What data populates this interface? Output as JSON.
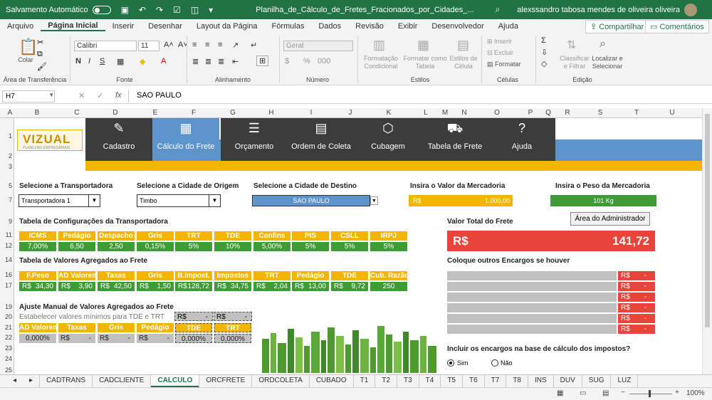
{
  "titlebar": {
    "autosave": "Salvamento Automático",
    "filename": "Planilha_de_Cálculo_de_Fretes_Fracionados_por_Cidades_...",
    "user": "alexssandro tabosa mendes de oliveira oliveira"
  },
  "tabs": [
    "Arquivo",
    "Página Inicial",
    "Inserir",
    "Desenhar",
    "Layout da Página",
    "Fórmulas",
    "Dados",
    "Revisão",
    "Exibir",
    "Desenvolvedor",
    "Ajuda"
  ],
  "share": {
    "compartilhar": "Compartilhar",
    "comentarios": "Comentários"
  },
  "ribbon": {
    "colar": "Colar",
    "area_transferencia": "Área de Transferência",
    "font_name": "Calibri",
    "font_size": "11",
    "fonte": "Fonte",
    "alinhamento": "Alinhamento",
    "num_format": "Geral",
    "numero": "Número",
    "cond_format": "Formatação Condicional",
    "fmt_tabela": "Formatar como Tabela",
    "estilos_cel": "Estilos de Célula",
    "estilos": "Estilos",
    "inserir": "Inserir",
    "excluir": "Excluir",
    "formatar": "Formatar",
    "celulas": "Células",
    "classificar": "Classificar e Filtrar",
    "localizar": "Localizar e Selecionar",
    "edicao": "Edição",
    "sum": "Σ"
  },
  "formula": {
    "namebox": "H7",
    "fx": "fx",
    "value": "SAO PAULO"
  },
  "columns": [
    "A",
    "B",
    "C",
    "D",
    "E",
    "F",
    "G",
    "H",
    "I",
    "J",
    "K",
    "L",
    "M",
    "N",
    "O",
    "P",
    "Q",
    "R",
    "S",
    "T",
    "U"
  ],
  "rows": [
    "1",
    "2",
    "3",
    "5",
    "7",
    "9",
    "11",
    "12",
    "14",
    "16",
    "17",
    "19",
    "20",
    "21",
    "22",
    "23",
    "24",
    "25"
  ],
  "banner": {
    "logo": "VIZUAL",
    "logo_sub": "PLANILHAS EMPRESARIAIS",
    "nav": [
      {
        "label": "Cadastro",
        "icon": "✎"
      },
      {
        "label": "Cálculo do Frete",
        "icon": "▦"
      },
      {
        "label": "Orçamento",
        "icon": "☰"
      },
      {
        "label": "Ordem de Coleta",
        "icon": "▤"
      },
      {
        "label": "Cubagem",
        "icon": "⬡"
      },
      {
        "label": "Tabela de Frete",
        "icon": "⛟"
      },
      {
        "label": "Ajuda",
        "icon": "?"
      }
    ]
  },
  "selectors": {
    "transportadora_label": "Selecione a Transportadora",
    "transportadora_value": "Transportadora 1",
    "origem_label": "Selecione a Cidade de Origem",
    "origem_value": "Timbo",
    "destino_label": "Selecione a Cidade de Destino",
    "destino_value": "SAO PAULO",
    "valor_label": "Insira o Valor da Mercadoria",
    "valor_currency": "R$",
    "valor_value": "1.000,00",
    "peso_label": "Insira o Peso da Mercadoria",
    "peso_value": "101 Kg"
  },
  "config": {
    "title": "Tabela de Configurações da Transportadora",
    "headers": [
      "ICMS",
      "Pedágio",
      "Despacho",
      "Gris",
      "TRT",
      "TDE",
      "Confins",
      "PIS",
      "CSLL",
      "IRPJ"
    ],
    "values": [
      "7,00%",
      "6,50",
      "2,50",
      "0,15%",
      "5%",
      "10%",
      "5,00%",
      "5%",
      "5%",
      "5%"
    ]
  },
  "agregados": {
    "title": "Tabela de Valores Agregados ao Frete",
    "headers": [
      "F.Peso",
      "AD Valorem",
      "Taxas",
      "Gris",
      "B.impost.",
      "Impostos",
      "TRT",
      "Pedágio",
      "TDE",
      "Cub. Razão"
    ],
    "values": [
      [
        "R$",
        "34,30"
      ],
      [
        "R$",
        "3,90"
      ],
      [
        "R$",
        "42,50"
      ],
      [
        "R$",
        "1,50"
      ],
      [
        "R$",
        "128,72"
      ],
      [
        "R$",
        "34,75"
      ],
      [
        "R$",
        "2,04"
      ],
      [
        "R$",
        "13,00"
      ],
      [
        "R$",
        "9,72"
      ],
      [
        "",
        "250"
      ]
    ]
  },
  "manual": {
    "title": "Ajuste Manual de Valores Agregados ao Frete",
    "subtitle": "Estabelecer valores mínimos para TDE e TRT",
    "mins": [
      [
        "R$",
        "-"
      ],
      [
        "R$",
        "-"
      ]
    ],
    "headers": [
      "AD Valorem",
      "Taxas",
      "Gris",
      "Pedágio",
      "TDE",
      "TRT"
    ],
    "values": [
      [
        "",
        "0,000%"
      ],
      [
        "R$",
        "-"
      ],
      [
        "R$",
        "-"
      ],
      [
        "R$",
        "-"
      ],
      [
        "",
        "0,000%"
      ],
      [
        "",
        "0,000%"
      ]
    ]
  },
  "total": {
    "label": "Valor Total do Frete",
    "admin_button": "Área do Administrador",
    "currency": "R$",
    "value": "141,72"
  },
  "encargos": {
    "title": "Coloque outros Encargos se houver",
    "rows": [
      [
        "R$",
        "-"
      ],
      [
        "R$",
        "-"
      ],
      [
        "R$",
        "-"
      ],
      [
        "R$",
        "-"
      ],
      [
        "R$",
        "-"
      ],
      [
        "R$",
        "-"
      ]
    ],
    "question": "Incluir os encargos na base de cálculo dos impostos?",
    "sim": "Sim",
    "nao": "Não"
  },
  "sheets": [
    "CADTRANS",
    "CADCLIENTE",
    "CALCULO",
    "ORCFRETE",
    "ORDCOLETA",
    "CUBADO",
    "T1",
    "T2",
    "T3",
    "T4",
    "T5",
    "T6",
    "T7",
    "T8",
    "INS",
    "DUV",
    "SUG",
    "LUZ"
  ],
  "status": {
    "zoom": "100%"
  },
  "colors": {
    "green": "#217346",
    "yellow": "#f2b600",
    "blue": "#5d94cc",
    "dark": "#3c3c3c",
    "red": "#e8443a",
    "cellgreen": "#3f9b35"
  }
}
